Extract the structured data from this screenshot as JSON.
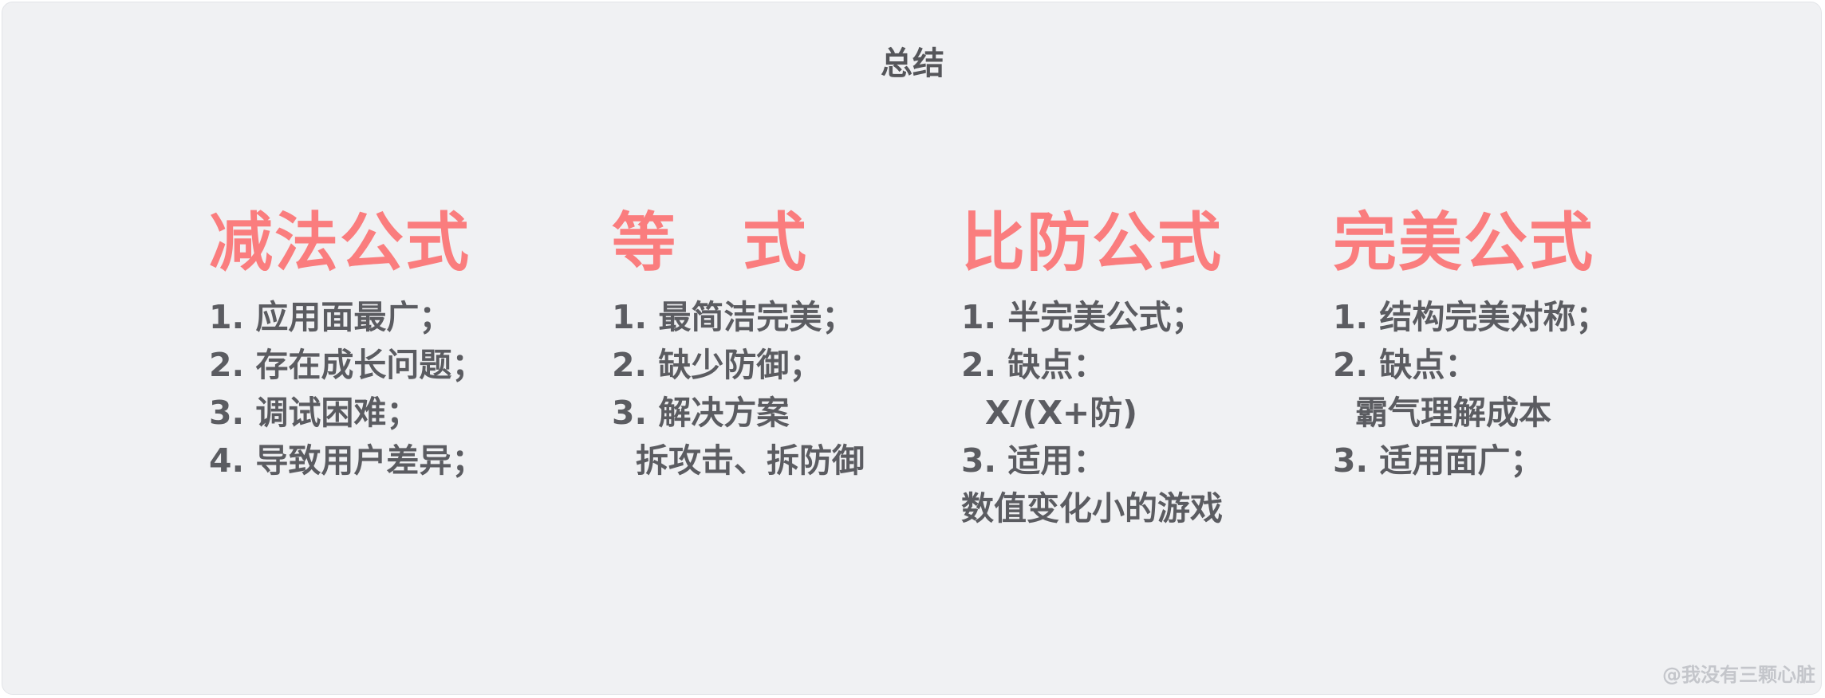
{
  "title": "总结",
  "columns": [
    {
      "heading": "减法公式",
      "items": [
        "1. 应用面最广；",
        "2. 存在成长问题；",
        "3. 调试困难；",
        "4. 导致用户差异；"
      ]
    },
    {
      "heading": "等　式",
      "items": [
        "1. 最简洁完美；",
        "2. 缺少防御；",
        "3. 解决方案",
        "拆攻击、拆防御"
      ]
    },
    {
      "heading": "比防公式",
      "items": [
        "1. 半完美公式；",
        "2. 缺点：",
        "X/(X+防)",
        "3. 适用：",
        "数值变化小的游戏"
      ]
    },
    {
      "heading": "完美公式",
      "items": [
        "1. 结构完美对称；",
        "2. 缺点：",
        "霸气理解成本",
        "3. 适用面广；"
      ]
    }
  ],
  "watermark": "@我没有三颗心脏"
}
